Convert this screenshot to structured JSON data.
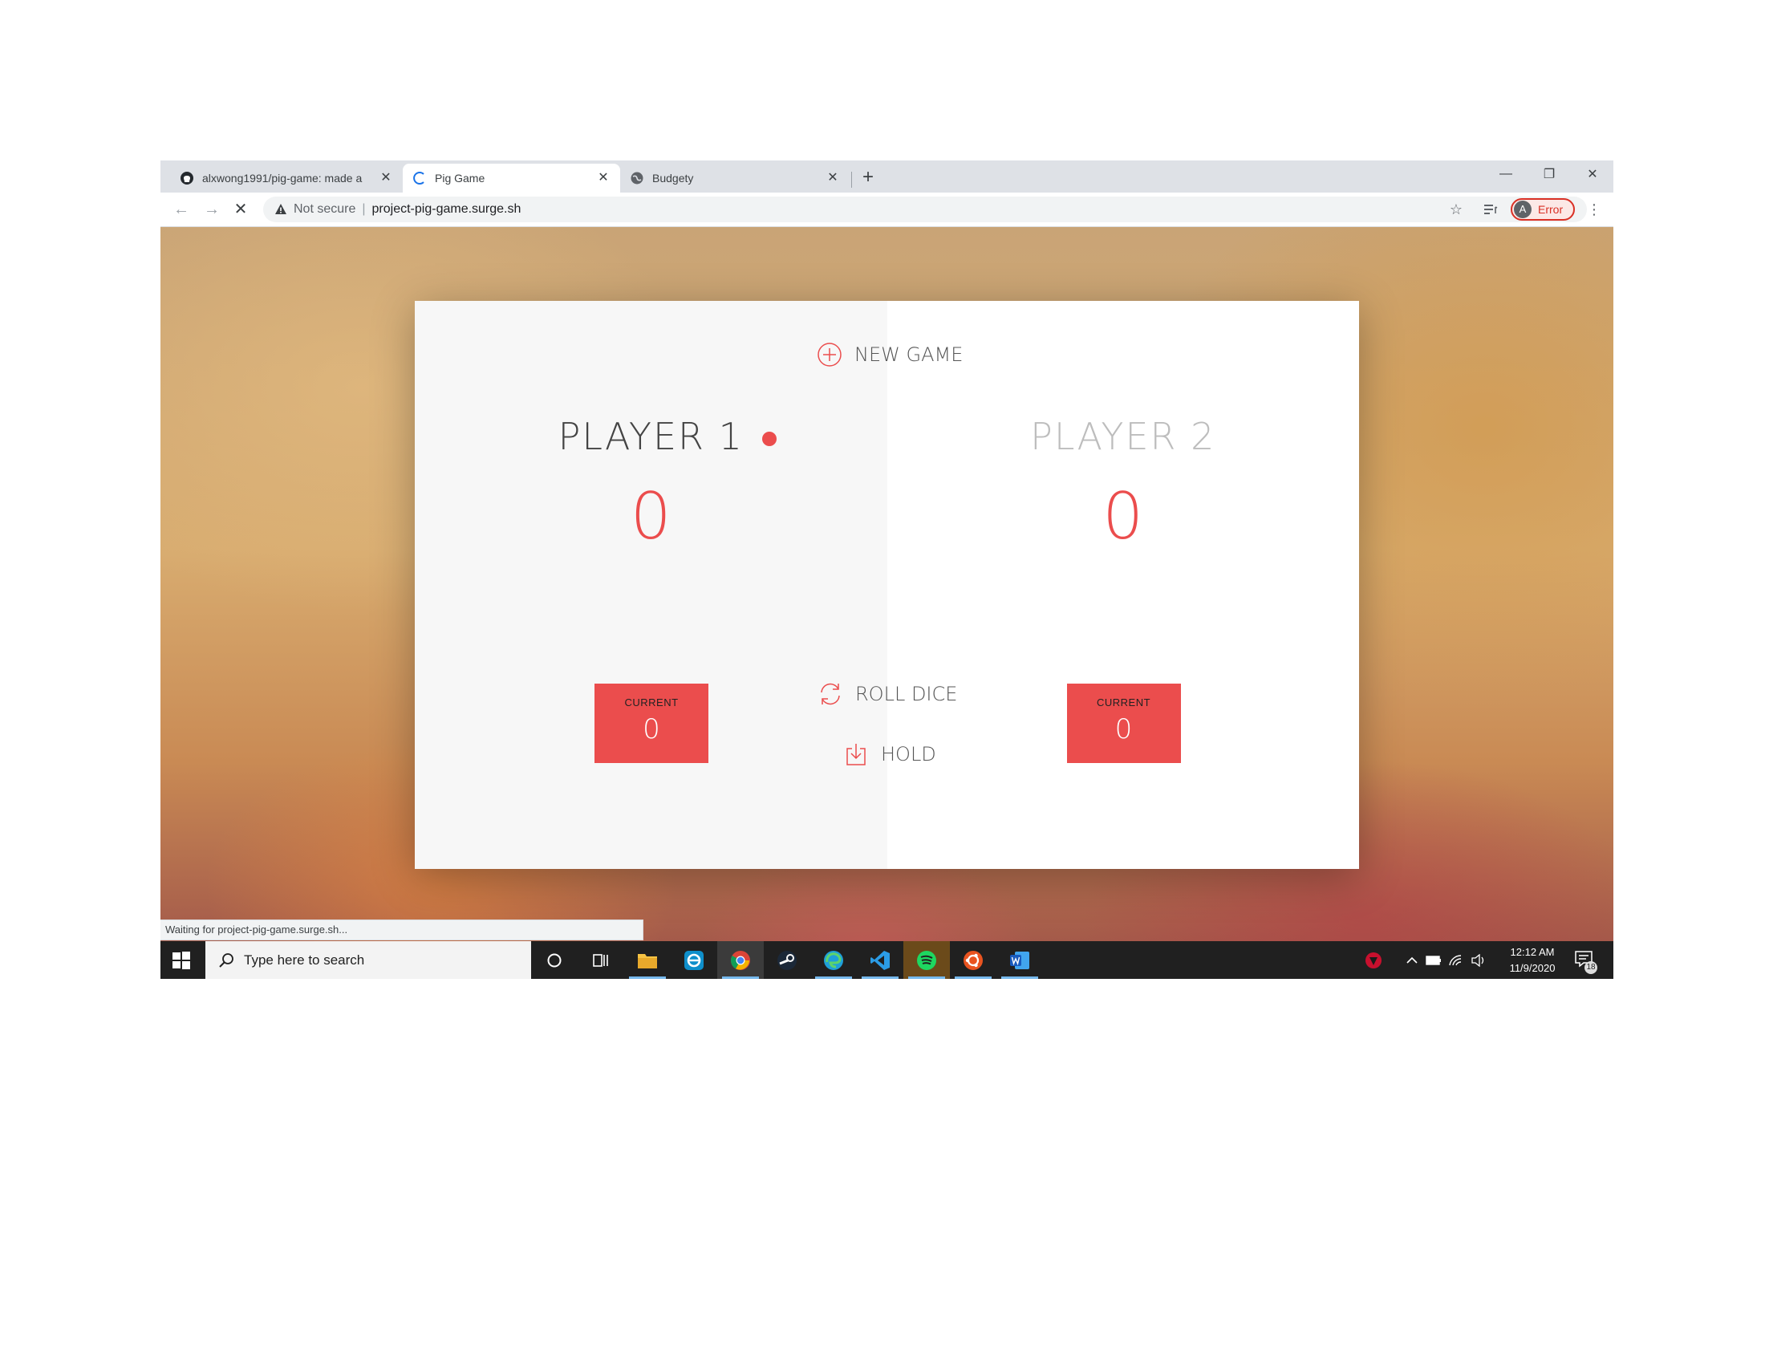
{
  "browser": {
    "tabs": [
      {
        "title": "alxwong1991/pig-game: made a",
        "favicon": "github-icon",
        "active": false
      },
      {
        "title": "Pig Game",
        "favicon": "loading-spinner-icon",
        "active": true
      },
      {
        "title": "Budgety",
        "favicon": "globe-icon",
        "active": false
      }
    ],
    "security_label": "Not secure",
    "separator": "|",
    "url": "project-pig-game.surge.sh",
    "profile_initial": "A",
    "profile_status": "Error",
    "status_text": "Waiting for project-pig-game.surge.sh..."
  },
  "game": {
    "new_game_label": "NEW GAME",
    "roll_dice_label": "ROLL DICE",
    "hold_label": "HOLD",
    "current_label": "CURRENT",
    "active_player": 1,
    "players": [
      {
        "name": "PLAYER 1",
        "score": "0",
        "current": "0"
      },
      {
        "name": "PLAYER 2",
        "score": "0",
        "current": "0"
      }
    ],
    "accent_color": "#eb4d4d"
  },
  "taskbar": {
    "search_placeholder": "Type here to search",
    "apps": [
      "cortana-icon",
      "task-view-icon",
      "file-explorer-icon",
      "edge-legacy-icon",
      "chrome-icon",
      "steam-icon",
      "edge-icon",
      "vscode-icon",
      "spotify-icon",
      "ubuntu-icon",
      "word-icon"
    ],
    "time": "12:12 AM",
    "date": "11/9/2020",
    "notification_count": "18"
  }
}
